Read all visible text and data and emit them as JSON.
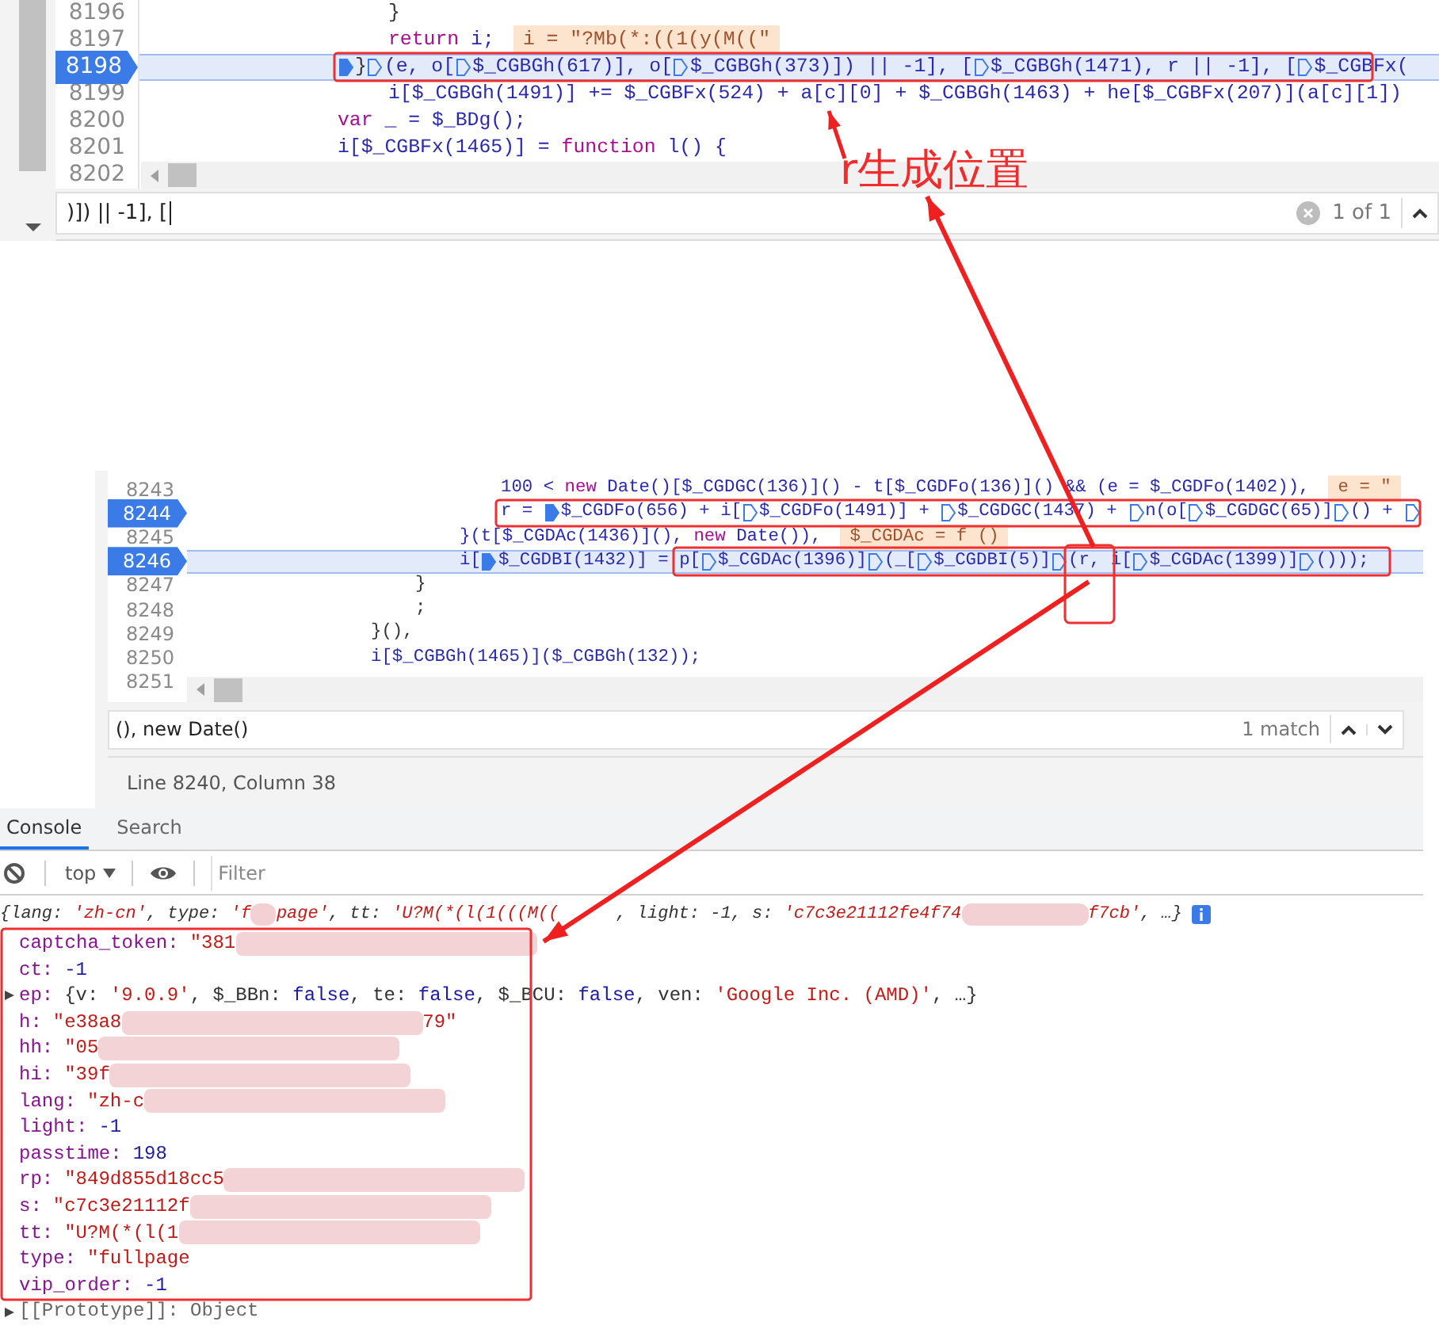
{
  "top_editor": {
    "lines": [
      {
        "number": "8196",
        "breakpoint": false,
        "current": false,
        "segments": [
          {
            "kind": "text",
            "runs": [
              {
                "kind": "plain",
                "text": "}"
              }
            ]
          }
        ]
      },
      {
        "number": "8197",
        "breakpoint": false,
        "current": false,
        "segments": [
          {
            "kind": "text",
            "runs": [
              {
                "kind": "keyword",
                "text": "return"
              },
              {
                "kind": "ident",
                "text": " i;"
              }
            ]
          }
        ],
        "inline_value": "i = \"?Mb(*:((1(y(M((\""
      },
      {
        "number": "8198",
        "breakpoint": true,
        "current": true,
        "segments": [
          {
            "kind": "marker",
            "active": true
          },
          {
            "kind": "text",
            "runs": [
              {
                "kind": "plain",
                "text": "}"
              }
            ]
          },
          {
            "kind": "marker",
            "active": false
          },
          {
            "kind": "text",
            "runs": [
              {
                "kind": "ident",
                "text": "(e, o["
              }
            ]
          },
          {
            "kind": "marker",
            "active": false
          },
          {
            "kind": "text",
            "runs": [
              {
                "kind": "ident",
                "text": "$_CGBGh(617)], o["
              }
            ]
          },
          {
            "kind": "marker",
            "active": false
          },
          {
            "kind": "text",
            "runs": [
              {
                "kind": "ident",
                "text": "$_CGBGh(373)]) || -1], ["
              }
            ]
          },
          {
            "kind": "marker",
            "active": false
          },
          {
            "kind": "text",
            "runs": [
              {
                "kind": "ident",
                "text": "$_CGBGh(1471), r || -1], ["
              }
            ]
          },
          {
            "kind": "marker",
            "active": false
          },
          {
            "kind": "text",
            "runs": [
              {
                "kind": "ident",
                "text": "$_CGBFx("
              }
            ]
          }
        ]
      },
      {
        "number": "8199",
        "breakpoint": false,
        "current": false,
        "segments": [
          {
            "kind": "text",
            "runs": [
              {
                "kind": "ident",
                "text": "i[$_CGBGh(1491)] += $_CGBFx(524) + a[c][0] + $_CGBGh(1463) + he[$_CGBFx(207)](a[c][1])"
              }
            ]
          }
        ]
      },
      {
        "number": "8200",
        "breakpoint": false,
        "current": false,
        "segments": [
          {
            "kind": "text",
            "runs": [
              {
                "kind": "keyword",
                "text": "var"
              },
              {
                "kind": "ident",
                "text": " _ = $_BDg();"
              }
            ]
          }
        ]
      },
      {
        "number": "8201",
        "breakpoint": false,
        "current": false,
        "segments": [
          {
            "kind": "text",
            "runs": [
              {
                "kind": "ident",
                "text": "i[$_CGBFx(1465)] = "
              },
              {
                "kind": "keyword",
                "text": "function"
              },
              {
                "kind": "ident",
                "text": " l() {"
              }
            ]
          }
        ]
      },
      {
        "number": "8202",
        "breakpoint": false,
        "current": false
      }
    ],
    "search": {
      "value": ")]) || -1], [",
      "result": "1 of 1"
    }
  },
  "annotation": {
    "label": "r生成位置"
  },
  "middle_editor": {
    "lines": [
      {
        "number": "8243",
        "breakpoint": false,
        "current": false,
        "segments": [
          {
            "kind": "text",
            "runs": [
              {
                "kind": "ident",
                "text": "100 < "
              },
              {
                "kind": "keyword",
                "text": "new"
              },
              {
                "kind": "ident",
                "text": " Date()[$_CGDGC(136)]() - t[$_CGDFo(136)]() && (e = $_CGDFo(1402)),"
              }
            ]
          }
        ],
        "inline_value": "e = \""
      },
      {
        "number": "8244",
        "breakpoint": true,
        "current": false,
        "segments": [
          {
            "kind": "text",
            "runs": [
              {
                "kind": "ident",
                "text": "r = "
              }
            ]
          },
          {
            "kind": "marker",
            "active": true
          },
          {
            "kind": "text",
            "runs": [
              {
                "kind": "ident",
                "text": "$_CGDFo(656) + i["
              }
            ]
          },
          {
            "kind": "marker",
            "active": false
          },
          {
            "kind": "text",
            "runs": [
              {
                "kind": "ident",
                "text": "$_CGDFo(1491)] + "
              }
            ]
          },
          {
            "kind": "marker",
            "active": false
          },
          {
            "kind": "text",
            "runs": [
              {
                "kind": "ident",
                "text": "$_CGDGC(1437) + "
              }
            ]
          },
          {
            "kind": "marker",
            "active": false
          },
          {
            "kind": "text",
            "runs": [
              {
                "kind": "ident",
                "text": "n(o["
              }
            ]
          },
          {
            "kind": "marker",
            "active": false
          },
          {
            "kind": "text",
            "runs": [
              {
                "kind": "ident",
                "text": "$_CGDGC(65)]"
              }
            ]
          },
          {
            "kind": "marker",
            "active": false
          },
          {
            "kind": "text",
            "runs": [
              {
                "kind": "ident",
                "text": "() + "
              }
            ]
          },
          {
            "kind": "marker",
            "active": false
          }
        ]
      },
      {
        "number": "8245",
        "breakpoint": false,
        "current": false,
        "segments": [
          {
            "kind": "text",
            "runs": [
              {
                "kind": "ident",
                "text": "}(t[$_CGDAc(1436)](), "
              },
              {
                "kind": "keyword",
                "text": "new"
              },
              {
                "kind": "ident",
                "text": " Date()),"
              }
            ]
          }
        ],
        "inline_value": "$_CGDAc = f ()"
      },
      {
        "number": "8246",
        "breakpoint": true,
        "current": true,
        "segments": [
          {
            "kind": "text",
            "runs": [
              {
                "kind": "ident",
                "text": "i["
              }
            ]
          },
          {
            "kind": "marker",
            "active": true
          },
          {
            "kind": "text",
            "runs": [
              {
                "kind": "ident",
                "text": "$_CGDBI(1432)] = p["
              }
            ]
          },
          {
            "kind": "marker",
            "active": false
          },
          {
            "kind": "text",
            "runs": [
              {
                "kind": "ident",
                "text": "$_CGDAc(1396)]"
              }
            ]
          },
          {
            "kind": "marker",
            "active": false
          },
          {
            "kind": "text",
            "runs": [
              {
                "kind": "ident",
                "text": "(_["
              }
            ]
          },
          {
            "kind": "marker",
            "active": false
          },
          {
            "kind": "text",
            "runs": [
              {
                "kind": "ident",
                "text": "$_CGDBI(5)]"
              }
            ]
          },
          {
            "kind": "marker",
            "active": false
          },
          {
            "kind": "text",
            "runs": [
              {
                "kind": "ident",
                "text": "(r, i["
              }
            ]
          },
          {
            "kind": "marker",
            "active": false
          },
          {
            "kind": "text",
            "runs": [
              {
                "kind": "ident",
                "text": "$_CGDAc(1399)]"
              }
            ]
          },
          {
            "kind": "marker",
            "active": false
          },
          {
            "kind": "text",
            "runs": [
              {
                "kind": "ident",
                "text": "()));"
              }
            ]
          }
        ]
      },
      {
        "number": "8247",
        "breakpoint": false,
        "current": false,
        "segments": [
          {
            "kind": "text",
            "runs": [
              {
                "kind": "plain",
                "text": "}"
              }
            ]
          }
        ]
      },
      {
        "number": "8248",
        "breakpoint": false,
        "current": false,
        "segments": [
          {
            "kind": "text",
            "runs": [
              {
                "kind": "plain",
                "text": ";"
              }
            ]
          }
        ]
      },
      {
        "number": "8249",
        "breakpoint": false,
        "current": false,
        "segments": [
          {
            "kind": "text",
            "runs": [
              {
                "kind": "plain",
                "text": "}(),"
              }
            ]
          }
        ]
      },
      {
        "number": "8250",
        "breakpoint": false,
        "current": false,
        "segments": [
          {
            "kind": "text",
            "runs": [
              {
                "kind": "ident",
                "text": "i[$_CGBGh(1465)]($_CGBGh(132));"
              }
            ]
          }
        ]
      },
      {
        "number": "8251",
        "breakpoint": false,
        "current": false
      }
    ],
    "search": {
      "value": "(), new Date()",
      "result": "1 match"
    },
    "status_bar": "Line 8240, Column 38"
  },
  "console": {
    "tabs": [
      {
        "label": "Console",
        "selected": true
      },
      {
        "label": "Search",
        "selected": false
      }
    ],
    "context": "top",
    "filter": {
      "placeholder": "Filter"
    },
    "summary": [
      {
        "kind": "text",
        "runs": [
          {
            "kind": "plain",
            "text": "{lang: "
          },
          {
            "kind": "string",
            "text": "'zh-cn'"
          },
          {
            "kind": "plain",
            "text": ", type: "
          },
          {
            "kind": "string",
            "text": "'f"
          }
        ]
      },
      {
        "kind": "redacted"
      },
      {
        "kind": "text",
        "runs": [
          {
            "kind": "string",
            "text": "page'"
          },
          {
            "kind": "plain",
            "text": ", tt: "
          },
          {
            "kind": "string",
            "text": "'U?M(*(l(1(((M(("
          }
        ]
      },
      {
        "kind": "text",
        "runs": [
          {
            "kind": "plain",
            "text": ", light: -1, s: "
          },
          {
            "kind": "string",
            "text": "'c7c3e21112fe4f74"
          }
        ]
      },
      {
        "kind": "redacted"
      },
      {
        "kind": "text",
        "runs": [
          {
            "kind": "string",
            "text": "f7cb'"
          },
          {
            "kind": "plain",
            "text": ", …}"
          }
        ]
      }
    ],
    "properties": [
      {
        "key": "captcha_token:",
        "kind": "value",
        "runs": [
          {
            "kind": "string",
            "text": "\"381"
          }
        ],
        "redacted": true
      },
      {
        "key": "ct:",
        "kind": "value",
        "runs": [
          {
            "kind": "number",
            "text": "-1"
          }
        ],
        "redacted": false
      },
      {
        "key": "ep:",
        "kind": "object",
        "expanded": false,
        "runs": [
          {
            "kind": "plain",
            "text": "{v: "
          },
          {
            "kind": "string",
            "text": "'9.0.9'"
          },
          {
            "kind": "plain",
            "text": ", $_BBn: "
          },
          {
            "kind": "number",
            "text": "false"
          },
          {
            "kind": "plain",
            "text": ", te: "
          },
          {
            "kind": "number",
            "text": "false"
          },
          {
            "kind": "plain",
            "text": ", $_BCU: "
          },
          {
            "kind": "number",
            "text": "false"
          },
          {
            "kind": "plain",
            "text": ", ven: "
          },
          {
            "kind": "string",
            "text": "'Google Inc. (AMD)'"
          },
          {
            "kind": "plain",
            "text": ", …}"
          }
        ],
        "redacted": false
      },
      {
        "key": "h:",
        "kind": "value",
        "runs": [
          {
            "kind": "string",
            "text": "\"e38a8"
          }
        ],
        "redacted": true,
        "tail": "79\""
      },
      {
        "key": "hh:",
        "kind": "value",
        "runs": [
          {
            "kind": "string",
            "text": "\"05"
          }
        ],
        "redacted": true
      },
      {
        "key": "hi:",
        "kind": "value",
        "runs": [
          {
            "kind": "string",
            "text": "\"39f"
          }
        ],
        "redacted": true
      },
      {
        "key": "lang:",
        "kind": "value",
        "runs": [
          {
            "kind": "string",
            "text": "\"zh-c"
          }
        ],
        "redacted": true
      },
      {
        "key": "light:",
        "kind": "value",
        "runs": [
          {
            "kind": "number",
            "text": "-1"
          }
        ],
        "redacted": false
      },
      {
        "key": "passtime:",
        "kind": "value",
        "runs": [
          {
            "kind": "number",
            "text": "198"
          }
        ],
        "redacted": false
      },
      {
        "key": "rp:",
        "kind": "value",
        "runs": [
          {
            "kind": "string",
            "text": "\"849d855d18cc5"
          }
        ],
        "redacted": true
      },
      {
        "key": "s:",
        "kind": "value",
        "runs": [
          {
            "kind": "string",
            "text": "\"c7c3e21112f"
          }
        ],
        "redacted": true
      },
      {
        "key": "tt:",
        "kind": "value",
        "runs": [
          {
            "kind": "string",
            "text": "\"U?M(*(l(1"
          }
        ],
        "redacted": true
      },
      {
        "key": "type:",
        "kind": "value",
        "runs": [
          {
            "kind": "string",
            "text": "\"fullpage"
          }
        ],
        "redacted": false
      },
      {
        "key": "vip_order:",
        "kind": "value",
        "runs": [
          {
            "kind": "number",
            "text": "-1"
          }
        ],
        "redacted": false
      }
    ],
    "prototype": {
      "label": "[[Prototype]]: Object",
      "expanded": false
    }
  }
}
